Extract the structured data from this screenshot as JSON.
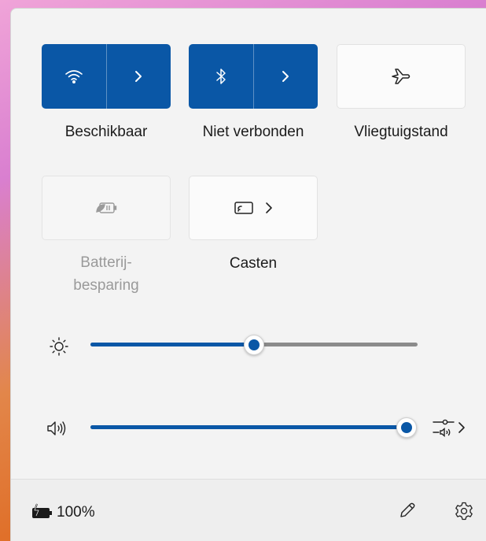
{
  "tiles": {
    "wifi": {
      "label": "Beschikbaar",
      "icon": "wifi-icon",
      "state": "on"
    },
    "bluetooth": {
      "label": "Niet verbonden",
      "icon": "bluetooth-icon",
      "state": "on"
    },
    "airplane": {
      "label": "Vliegtuigstand",
      "icon": "airplane-icon",
      "state": "off"
    },
    "battery_saver": {
      "label_line1": "Batterij-",
      "label_line2": "besparing",
      "icon": "battery-saver-icon",
      "state": "disabled"
    },
    "cast": {
      "label": "Casten",
      "icon": "cast-icon",
      "state": "off"
    }
  },
  "sliders": {
    "brightness": {
      "icon": "brightness-icon",
      "level_percent": 50
    },
    "volume": {
      "icon": "speaker-icon",
      "level_percent": 100
    }
  },
  "footer": {
    "battery_text": "100%",
    "battery_icon": "battery-charging-icon",
    "edit_icon": "pencil-icon",
    "settings_icon": "gear-icon"
  },
  "colors": {
    "accent": "#0a57a6",
    "panel": "#f3f3f3"
  }
}
